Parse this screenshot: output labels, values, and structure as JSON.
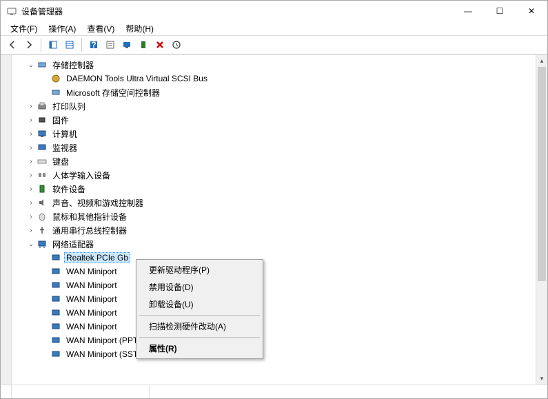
{
  "window": {
    "title": "设备管理器",
    "btn_min": "—",
    "btn_max": "☐",
    "btn_close": "✕"
  },
  "menu": {
    "file": "文件(F)",
    "action": "操作(A)",
    "view": "查看(V)",
    "help": "帮助(H)"
  },
  "toolbar": {
    "back": "←",
    "forward": "→",
    "up": "▦",
    "show": "▤",
    "help": "?",
    "props": "▦",
    "monitor": "🖥",
    "scan": "⇵",
    "remove": "✖",
    "refresh": "⭯"
  },
  "tree": {
    "storage_ctrl": "存储控制器",
    "daemon": "DAEMON Tools Ultra Virtual SCSI Bus",
    "ms_storage": "Microsoft 存储空间控制器",
    "print_queue": "打印队列",
    "firmware": "固件",
    "computer": "计算机",
    "monitor": "监视器",
    "keyboard": "键盘",
    "hid": "人体学输入设备",
    "software": "软件设备",
    "sound": "声音、视频和游戏控制器",
    "mouse": "鼠标和其他指针设备",
    "usb": "通用串行总线控制器",
    "network": "网络适配器",
    "realtek": "Realtek PCIe Gb",
    "wan1": "WAN Miniport",
    "wan2": "WAN Miniport",
    "wan3": "WAN Miniport",
    "wan4": "WAN Miniport",
    "wan5": "WAN Miniport",
    "wan6": "WAN Miniport (PPTP)",
    "wan7": "WAN Miniport (SSTP)"
  },
  "ctx": {
    "update_driver": "更新驱动程序(P)",
    "disable": "禁用设备(D)",
    "uninstall": "卸载设备(U)",
    "scan": "扫描检测硬件改动(A)",
    "properties": "属性(R)"
  },
  "icons": {
    "storage": "💾",
    "scsi": "📀",
    "printer": "🖨",
    "chip": "▭",
    "computer": "🖥",
    "monitor": "🖵",
    "keyboard": "⌨",
    "hid": "🎮",
    "software": "▪",
    "sound": "🔊",
    "mouse": "🖱",
    "usb": "🔌",
    "network": "🖧",
    "adapter": "🖳"
  }
}
